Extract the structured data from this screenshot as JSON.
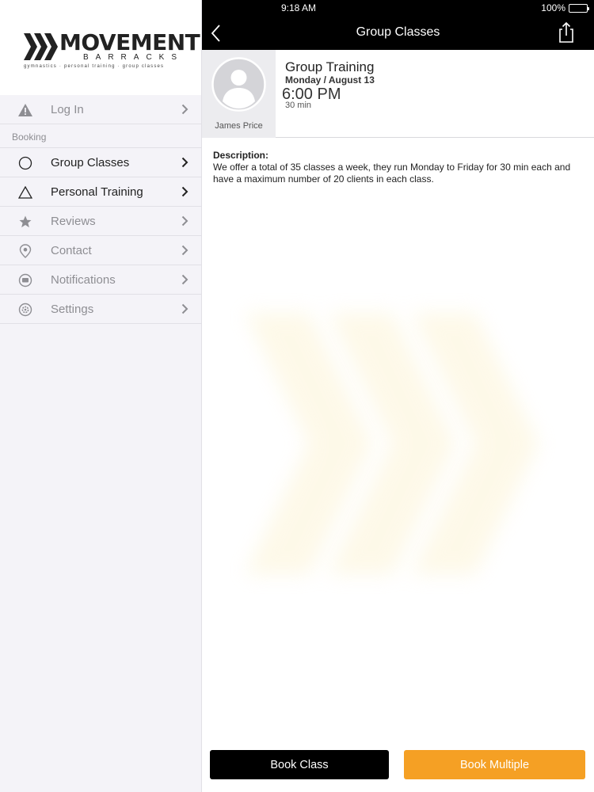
{
  "status_bar": {
    "time": "9:18 AM",
    "battery": "100%"
  },
  "sidebar": {
    "logo": {
      "word": "MOVEMENT",
      "sub": "BARRACKS",
      "tagline": "gymnastics · personal training · group classes"
    },
    "login_label": "Log In",
    "section_booking": "Booking",
    "items": [
      {
        "label": "Group Classes",
        "icon": "circle-icon"
      },
      {
        "label": "Personal Training",
        "icon": "triangle-icon"
      },
      {
        "label": "Reviews",
        "icon": "star-icon"
      },
      {
        "label": "Contact",
        "icon": "location-pin-icon"
      },
      {
        "label": "Notifications",
        "icon": "chat-bubble-icon"
      },
      {
        "label": "Settings",
        "icon": "gear-icon"
      }
    ]
  },
  "nav": {
    "title": "Group Classes",
    "back_icon": "chevron-left-icon",
    "share_icon": "share-icon"
  },
  "class": {
    "trainer": "James Price",
    "title": "Group Training",
    "date": "Monday / August 13",
    "time": "6:00 PM",
    "duration": "30 min"
  },
  "description": {
    "label": "Description:",
    "text": "We offer a total of 35 classes a week, they run Monday to Friday for 30 min each and have a maximum number of 20 clients in each class."
  },
  "buttons": {
    "book_class": "Book Class",
    "book_multiple": "Book Multiple"
  },
  "colors": {
    "accent": "#f5a024",
    "nav_bg": "#000000",
    "sidebar_bg": "#f4f3f8"
  }
}
